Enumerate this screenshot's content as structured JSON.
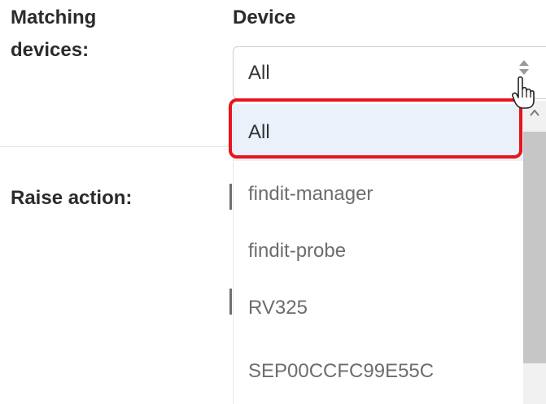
{
  "labels": {
    "matching_devices": "Matching devices:",
    "device": "Device",
    "raise_action": "Raise action:"
  },
  "device_select": {
    "selected_value": "All",
    "options": [
      {
        "label": "All",
        "selected": true
      },
      {
        "label": "findit-manager",
        "selected": false
      },
      {
        "label": "findit-probe",
        "selected": false
      },
      {
        "label": "RV325",
        "selected": false
      },
      {
        "label": "SEP00CCFC99E55C",
        "selected": false
      }
    ]
  },
  "colors": {
    "highlight_ring": "#e8141c",
    "selected_option_bg": "#eaf1fb",
    "label_text": "#2b2b2b",
    "option_text": "#6d6d6d"
  },
  "icons": {
    "select_arrow": "sort-arrows-icon",
    "cursor": "hand-pointer-icon",
    "scroll_up": "chevron-up-icon"
  }
}
